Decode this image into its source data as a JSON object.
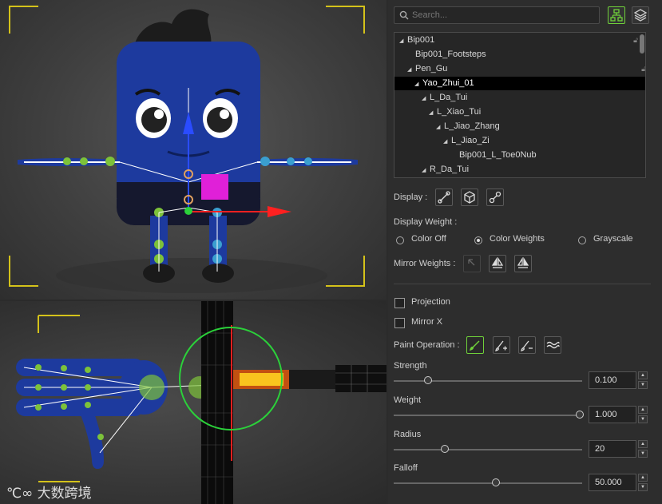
{
  "search": {
    "placeholder": "Search..."
  },
  "tree": {
    "items": [
      {
        "label": "Bip001",
        "expanded": true
      },
      {
        "label": "Bip001_Footsteps"
      },
      {
        "label": "Pen_Gu",
        "expanded": true
      },
      {
        "label": "Yao_Zhui_01",
        "expanded": true,
        "selected": true
      },
      {
        "label": "L_Da_Tui",
        "expanded": true
      },
      {
        "label": "L_Xiao_Tui",
        "expanded": true
      },
      {
        "label": "L_Jiao_Zhang",
        "expanded": true
      },
      {
        "label": "L_Jiao_Zi",
        "expanded": true
      },
      {
        "label": "Bip001_L_Toe0Nub"
      },
      {
        "label": "R_Da_Tui",
        "expanded": true
      }
    ]
  },
  "display": {
    "label": "Display :"
  },
  "display_weight": {
    "label": "Display Weight :",
    "options": [
      "Color Off",
      "Color Weights",
      "Grayscale"
    ],
    "selected": "Color Weights"
  },
  "mirror_weights": {
    "label": "Mirror Weights :"
  },
  "projection": {
    "label": "Projection",
    "checked": false
  },
  "mirror_x": {
    "label": "Mirror X",
    "checked": false
  },
  "paint_operation": {
    "label": "Paint Operation :"
  },
  "sliders": [
    {
      "label": "Strength",
      "value": "0.100",
      "fraction": 0.1
    },
    {
      "label": "Weight",
      "value": "1.000",
      "fraction": 1.0
    },
    {
      "label": "Radius",
      "value": "20",
      "fraction": 0.2
    },
    {
      "label": "Falloff",
      "value": "50.000",
      "fraction": 0.5
    }
  ],
  "watermark": {
    "text": "大数跨境"
  },
  "colors": {
    "accent_green": "#6fd13a",
    "character_blue": "#1d3a9e",
    "magenta": "#e020d8",
    "panel_bg": "#2d2d2d"
  }
}
